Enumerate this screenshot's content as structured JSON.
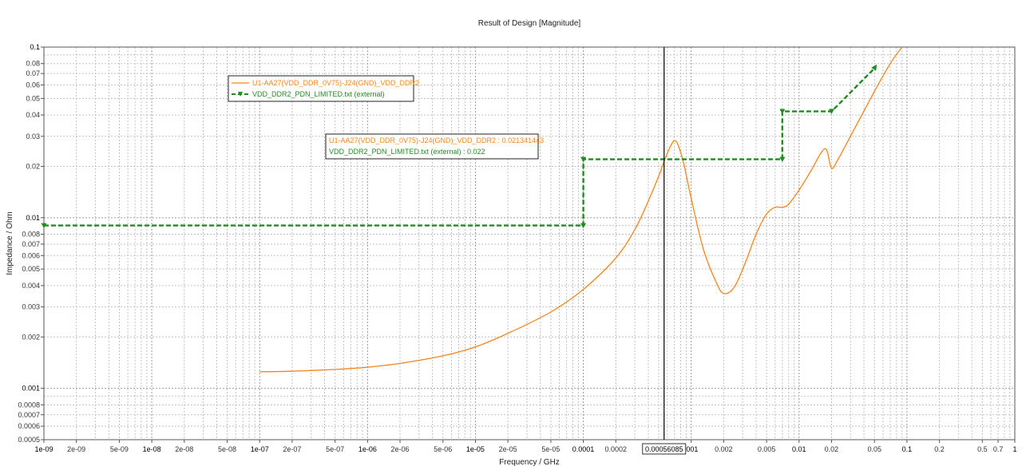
{
  "chart_data": {
    "type": "line",
    "title": "Result of Design [Magnitude]",
    "xlabel": "Frequency / GHz",
    "ylabel": "Impedance / Ohm",
    "x_scale": "log",
    "y_scale": "log",
    "xlim": [
      1e-09,
      1
    ],
    "ylim": [
      0.0005,
      0.1
    ],
    "grid": true,
    "legend_position": "top-left",
    "x_tick_labels": [
      {
        "v": 1e-09,
        "t": "1e-09",
        "major": true
      },
      {
        "v": 2e-09,
        "t": "2e-09",
        "major": false
      },
      {
        "v": 5e-09,
        "t": "5e-09",
        "major": false
      },
      {
        "v": 1e-08,
        "t": "1e-08",
        "major": true
      },
      {
        "v": 2e-08,
        "t": "2e-08",
        "major": false
      },
      {
        "v": 5e-08,
        "t": "5e-08",
        "major": false
      },
      {
        "v": 1e-07,
        "t": "1e-07",
        "major": true
      },
      {
        "v": 2e-07,
        "t": "2e-07",
        "major": false
      },
      {
        "v": 5e-07,
        "t": "5e-07",
        "major": false
      },
      {
        "v": 1e-06,
        "t": "1e-06",
        "major": true
      },
      {
        "v": 2e-06,
        "t": "2e-06",
        "major": false
      },
      {
        "v": 5e-06,
        "t": "5e-06",
        "major": false
      },
      {
        "v": 1e-05,
        "t": "1e-05",
        "major": true
      },
      {
        "v": 2e-05,
        "t": "2e-05",
        "major": false
      },
      {
        "v": 5e-05,
        "t": "5e-05",
        "major": false
      },
      {
        "v": 0.0001,
        "t": "0.0001",
        "major": true
      },
      {
        "v": 0.0002,
        "t": "0.0002",
        "major": false
      },
      {
        "v": 0.001,
        "t": ".001",
        "major": true
      },
      {
        "v": 0.002,
        "t": "0.002",
        "major": false
      },
      {
        "v": 0.005,
        "t": "0.005",
        "major": false
      },
      {
        "v": 0.01,
        "t": "0.01",
        "major": true
      },
      {
        "v": 0.02,
        "t": "0.02",
        "major": false
      },
      {
        "v": 0.05,
        "t": "0.05",
        "major": false
      },
      {
        "v": 0.1,
        "t": "0.1",
        "major": true
      },
      {
        "v": 0.2,
        "t": "0.2",
        "major": false
      },
      {
        "v": 0.5,
        "t": "0.5",
        "major": false
      },
      {
        "v": 0.7,
        "t": "0.7",
        "major": false
      },
      {
        "v": 1,
        "t": "1",
        "major": true
      }
    ],
    "y_tick_labels": [
      {
        "v": 0.1,
        "t": "0.1",
        "major": true
      },
      {
        "v": 0.08,
        "t": "0.08",
        "major": false
      },
      {
        "v": 0.07,
        "t": "0.07",
        "major": false
      },
      {
        "v": 0.06,
        "t": "0.06",
        "major": false
      },
      {
        "v": 0.05,
        "t": "0.05",
        "major": false
      },
      {
        "v": 0.04,
        "t": "0.04",
        "major": false
      },
      {
        "v": 0.03,
        "t": "0.03",
        "major": false
      },
      {
        "v": 0.02,
        "t": "0.02",
        "major": false
      },
      {
        "v": 0.01,
        "t": "0.01",
        "major": true
      },
      {
        "v": 0.008,
        "t": "0.008",
        "major": false
      },
      {
        "v": 0.007,
        "t": "0.007",
        "major": false
      },
      {
        "v": 0.006,
        "t": "0.006",
        "major": false
      },
      {
        "v": 0.005,
        "t": "0.005",
        "major": false
      },
      {
        "v": 0.004,
        "t": "0.004",
        "major": false
      },
      {
        "v": 0.003,
        "t": "0.003",
        "major": false
      },
      {
        "v": 0.002,
        "t": "0.002",
        "major": false
      },
      {
        "v": 0.001,
        "t": "0.001",
        "major": true
      },
      {
        "v": 0.0008,
        "t": "0.0008",
        "major": false
      },
      {
        "v": 0.0007,
        "t": "0.0007",
        "major": false
      },
      {
        "v": 0.0006,
        "t": "0.0006",
        "major": false
      },
      {
        "v": 0.0005,
        "t": "0.0005",
        "major": false
      }
    ],
    "series": [
      {
        "name": "U1-AA27(VDD_DDR_0V75)-J24(GND)_VDD_DDR2",
        "color": "#f0861c",
        "style": "solid",
        "x": [
          1e-07,
          2e-07,
          5e-07,
          1e-06,
          2e-06,
          5e-06,
          1e-05,
          2e-05,
          5e-05,
          0.0001,
          0.0002,
          0.0003,
          0.0004,
          0.0005,
          0.00056085,
          0.00062,
          0.00067,
          0.0007,
          0.00075,
          0.00085,
          0.001,
          0.0013,
          0.0017,
          0.002,
          0.0025,
          0.0032,
          0.004,
          0.005,
          0.006,
          0.007,
          0.008,
          0.01,
          0.013,
          0.016,
          0.018,
          0.02,
          0.023,
          0.03,
          0.05,
          0.07,
          0.09
        ],
        "y": [
          0.00125,
          0.00126,
          0.00129,
          0.00133,
          0.0014,
          0.00155,
          0.00175,
          0.0021,
          0.0028,
          0.0038,
          0.0058,
          0.0085,
          0.0125,
          0.0175,
          0.021341443,
          0.025,
          0.0275,
          0.0283,
          0.027,
          0.021,
          0.013,
          0.0065,
          0.0042,
          0.0036,
          0.0039,
          0.0055,
          0.008,
          0.0105,
          0.0115,
          0.0115,
          0.012,
          0.0145,
          0.019,
          0.024,
          0.025,
          0.0195,
          0.022,
          0.03,
          0.055,
          0.08,
          0.1
        ]
      },
      {
        "name": "VDD_DDR2_PDN_LIMITED.txt (external)",
        "color": "#228b22",
        "style": "dashed",
        "x": [
          1e-09,
          0.0001,
          0.0001,
          0.007,
          0.007,
          0.02,
          0.05
        ],
        "y": [
          0.009,
          0.009,
          0.022,
          0.022,
          0.042,
          0.042,
          0.075
        ]
      }
    ],
    "legend": {
      "items": [
        "U1-AA27(VDD_DDR_0V75)-J24(GND)_VDD_DDR2",
        "VDD_DDR2_PDN_LIMITED.txt (external)"
      ]
    },
    "cursor": {
      "x": 0.00056085,
      "label": "0.00056085",
      "readouts": [
        {
          "text": "U1-AA27(VDD_DDR_0V75)-J24(GND)_VDD_DDR2 : 0.021341443",
          "color": "#f0861c"
        },
        {
          "text": "VDD_DDR2_PDN_LIMITED.txt (external) : 0.022",
          "color": "#228b22"
        }
      ]
    }
  }
}
